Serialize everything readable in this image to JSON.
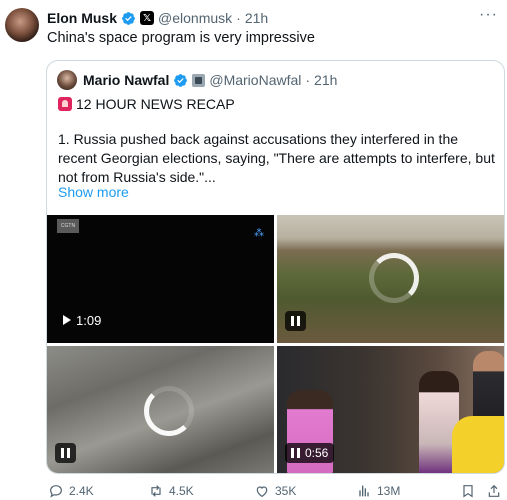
{
  "tweet": {
    "author_name": "Elon Musk",
    "author_handle": "@elonmusk",
    "separator": "·",
    "time": "21h",
    "affiliate_badge": "𝕏",
    "text": "China's space program is very impressive",
    "more_icon": "more-icon"
  },
  "quote": {
    "author_name": "Mario Nawfal",
    "author_handle": "@MarioNawfal",
    "separator": "·",
    "time": "21h",
    "headline": "12 HOUR NEWS RECAP",
    "body": "1. Russia pushed back against accusations they interfered in the recent Georgian elections, saying, \"There are attempts to interfere, but not from Russia's side.\"...",
    "show_more": "Show more",
    "media": [
      {
        "type": "video",
        "duration": "1:09",
        "watermark": "CGTN",
        "state": "play"
      },
      {
        "type": "video",
        "state": "pause",
        "loading": true
      },
      {
        "type": "video",
        "state": "pause",
        "loading": true
      },
      {
        "type": "video",
        "duration": "0:56",
        "state": "pause"
      }
    ]
  },
  "actions": {
    "replies": "2.4K",
    "reposts": "4.5K",
    "likes": "35K",
    "views": "13M"
  },
  "colors": {
    "accent": "#1d9bf0",
    "text": "#0f1419",
    "muted": "#536471",
    "border": "#cfd9de"
  }
}
